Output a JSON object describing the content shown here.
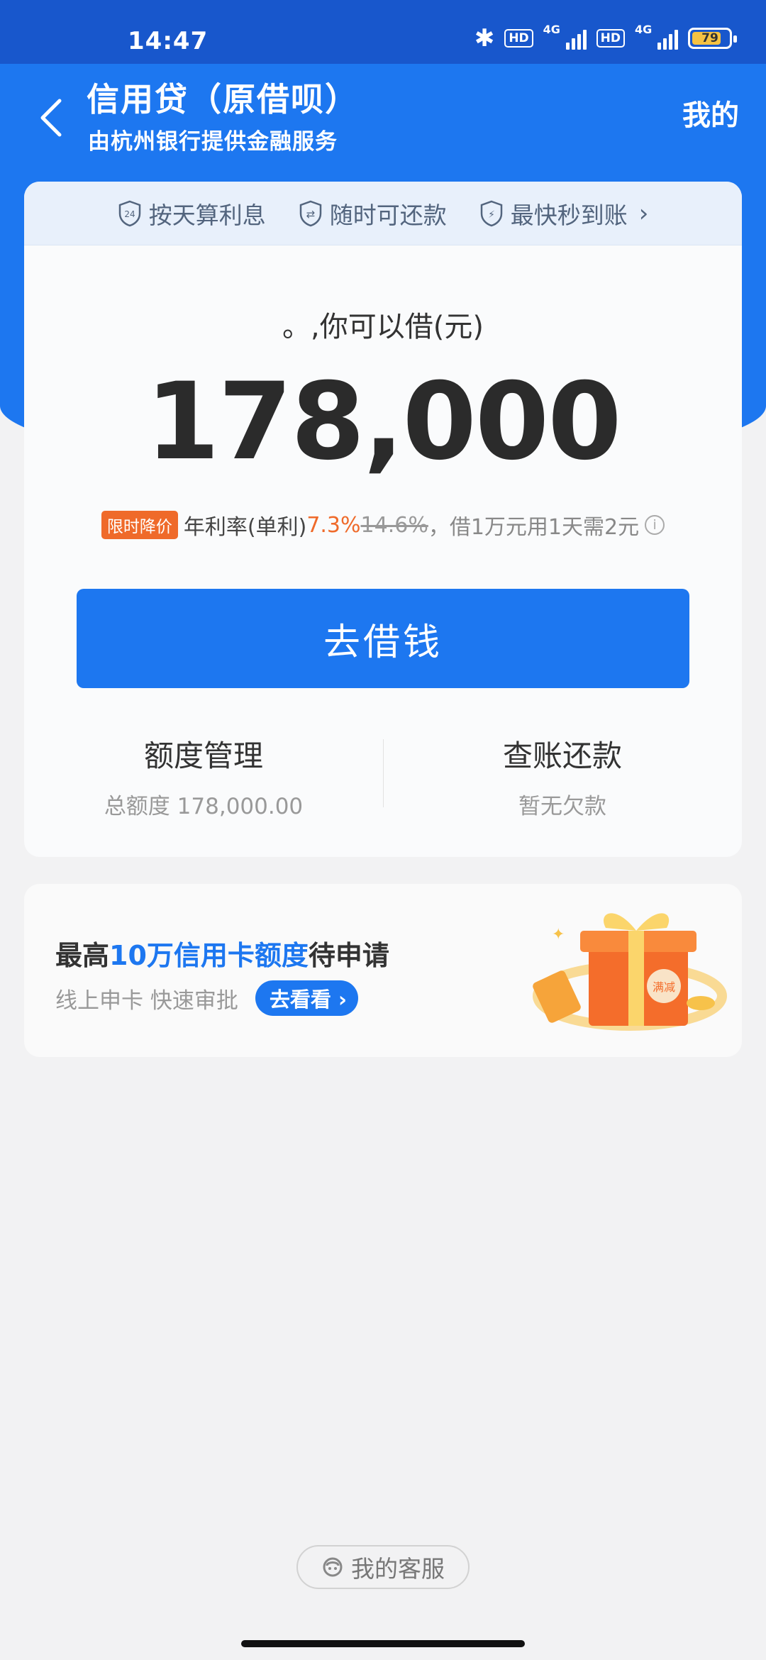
{
  "status_bar": {
    "time": "14:47",
    "hd": "HD",
    "network": "4G",
    "battery": "79"
  },
  "nav": {
    "title": "信用贷（原借呗）",
    "subtitle": "由杭州银行提供金融服务",
    "mine": "我的"
  },
  "features": [
    {
      "icon": "24",
      "label": "按天算利息"
    },
    {
      "icon": "⇄",
      "label": "随时可还款"
    },
    {
      "icon": "⚡",
      "label": "最快秒到账"
    }
  ],
  "loan": {
    "available_label": "。,你可以借(元)",
    "amount": "178,000",
    "promo_badge": "限时降价",
    "rate_label": "年利率(单利)",
    "rate_now": "7.3%",
    "rate_old": "14.6%",
    "rate_note": "，借1万元用1天需2元",
    "borrow_button": "去借钱"
  },
  "actions": {
    "limit": {
      "title": "额度管理",
      "sub": "总额度 178,000.00"
    },
    "bill": {
      "title": "查账还款",
      "sub": "暂无欠款"
    }
  },
  "promo": {
    "title_prefix": "最高",
    "title_highlight": "10万信用卡额度",
    "title_suffix": "待申请",
    "subtitle": "线上申卡 快速审批",
    "cta": "去看看",
    "gift_text": "满减"
  },
  "footer": {
    "service_label": "我的客服"
  },
  "colors": {
    "primary": "#1d77f0",
    "accent": "#ef6a2a",
    "status_bar": "#1857cc"
  }
}
